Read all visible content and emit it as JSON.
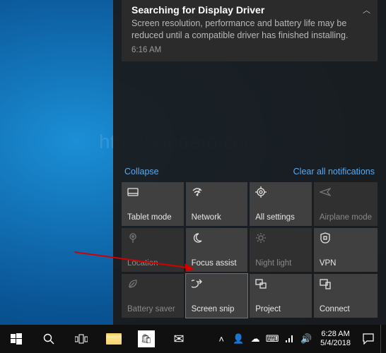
{
  "notification": {
    "title": "Searching for Display Driver",
    "body": "Screen resolution, performance and battery life may be reduced until a compatible driver has finished installing.",
    "time": "6:16 AM"
  },
  "actionCenter": {
    "collapse": "Collapse",
    "clear": "Clear all notifications"
  },
  "tiles": [
    {
      "name": "tablet-mode",
      "label": "Tablet mode",
      "icon": "tablet",
      "dim": false
    },
    {
      "name": "network",
      "label": "Network",
      "icon": "wifi",
      "dim": false
    },
    {
      "name": "all-settings",
      "label": "All settings",
      "icon": "gear",
      "dim": false
    },
    {
      "name": "airplane",
      "label": "Airplane mode",
      "icon": "airplane",
      "dim": true
    },
    {
      "name": "location",
      "label": "Location",
      "icon": "location",
      "dim": true
    },
    {
      "name": "focus-assist",
      "label": "Focus assist",
      "icon": "moon",
      "dim": false
    },
    {
      "name": "night-light",
      "label": "Night light",
      "icon": "sun",
      "dim": true
    },
    {
      "name": "vpn",
      "label": "VPN",
      "icon": "vpn",
      "dim": false
    },
    {
      "name": "battery-saver",
      "label": "Battery saver",
      "icon": "leaf",
      "dim": true
    },
    {
      "name": "screen-snip",
      "label": "Screen snip",
      "icon": "snip",
      "dim": false,
      "highlight": true
    },
    {
      "name": "project",
      "label": "Project",
      "icon": "project",
      "dim": false
    },
    {
      "name": "connect",
      "label": "Connect",
      "icon": "connect",
      "dim": false
    }
  ],
  "watermark": "http://winaero.com",
  "taskbar": {
    "time": "6:28 AM",
    "date": "5/4/2018"
  }
}
